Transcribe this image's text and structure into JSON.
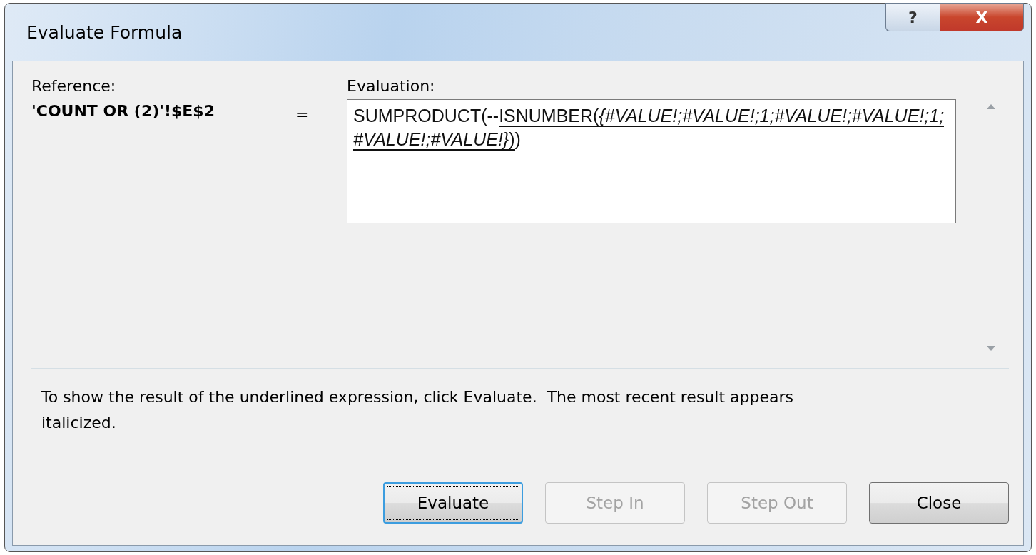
{
  "window": {
    "title": "Evaluate Formula",
    "controls": [
      {
        "kind": "help",
        "label": "?"
      },
      {
        "kind": "close",
        "label": "X"
      }
    ]
  },
  "reference": {
    "label": "Reference:",
    "value": "'COUNT OR (2)'!$E$2"
  },
  "equals": "=",
  "evaluation": {
    "label": "Evaluation:",
    "segments": [
      {
        "text": "SUMPRODUCT(--",
        "underlined": false,
        "italic": false
      },
      {
        "text": "ISNUMBER(",
        "underlined": true,
        "italic": false
      },
      {
        "text": "{#VALUE!;#VALUE!;1;#VALUE!;#VALUE!;1;#VALUE!;#VALUE!}",
        "underlined": true,
        "italic": true
      },
      {
        "text": ")",
        "underlined": true,
        "italic": false
      },
      {
        "text": ")",
        "underlined": false,
        "italic": false
      }
    ]
  },
  "hint": "To show the result of the underlined expression, click Evaluate.  The most recent result appears italicized.",
  "buttons": [
    {
      "label": "Evaluate",
      "disabled": false,
      "focused": true
    },
    {
      "label": "Step In",
      "disabled": true,
      "focused": false
    },
    {
      "label": "Step Out",
      "disabled": true,
      "focused": false
    },
    {
      "label": "Close",
      "disabled": false,
      "focused": false
    }
  ]
}
